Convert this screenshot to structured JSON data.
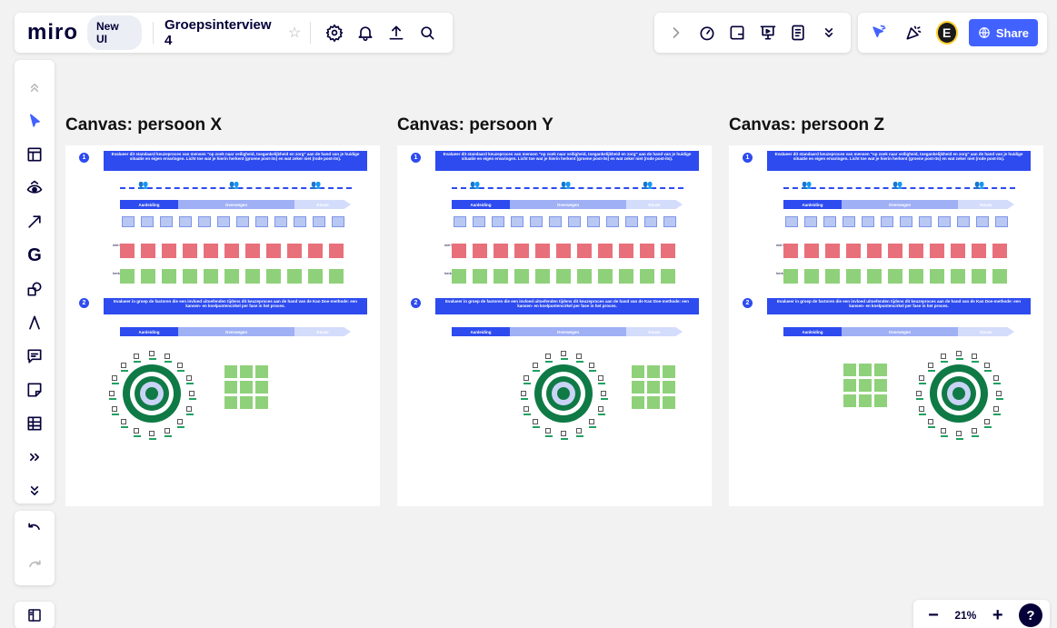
{
  "topbar": {
    "logo": "miro",
    "new_ui_label": "New UI",
    "board_name": "Groepsinterview 4",
    "icons": [
      "star-icon",
      "settings-icon",
      "bell-icon",
      "upload-icon",
      "search-icon"
    ]
  },
  "collab_toolbar": {
    "icons": [
      "chevron-right-icon",
      "timer-icon",
      "frame-icon",
      "presentation-icon",
      "notes-icon",
      "chevron-double-down-icon"
    ]
  },
  "share_toolbar": {
    "icons": [
      "cursor-reactions-icon",
      "party-icon"
    ],
    "avatar_initial": "E",
    "share_label": "Share"
  },
  "left_toolbar": {
    "tools": [
      "collapse-up-icon",
      "select-cursor-icon",
      "templates-icon",
      "ai-eye-icon",
      "arrow-line-icon",
      "g-app-icon",
      "shapes-icon",
      "pen-icon",
      "comment-icon",
      "sticky-note-icon",
      "table-icon",
      "more-tools-icon",
      "expand-down-icon"
    ]
  },
  "zoom": {
    "minus": "−",
    "value": "21%",
    "plus": "+",
    "help": "?"
  },
  "canvases": [
    {
      "title": "Canvas: persoon X",
      "step1_number": "1",
      "step1_text": "Evalueer dit standaard keuzeproces van mensen \"op zoek naar veiligheid, toegankelijkheid en zorg\" aan de hand van je huidige situatie en eigen ervaringen. Licht toe wat je hierin herkent (groene post-its) en wat zeker niet (rode post-its).",
      "phases": [
        "Aanleiding",
        "Overwegen",
        "Keuze"
      ],
      "red_label": "niet herkend",
      "green_label": "herkend",
      "step2_number": "2",
      "step2_text": "Evalueer in groep de factoren die een invloed uitoefenden tijdens dit keuzeproces aan de hand van de Kan Doe-methode: een kansen- en knelpuntencirkel per fase in het proces.",
      "circle_side": "left"
    },
    {
      "title": "Canvas: persoon Y",
      "step1_number": "1",
      "step1_text": "Evalueer dit standaard keuzeproces van mensen \"op zoek naar veiligheid, toegankelijkheid en zorg\" aan de hand van je huidige situatie en eigen ervaringen. Licht toe wat je hierin herkent (groene post-its) en wat zeker niet (rode post-its).",
      "phases": [
        "Aanleiding",
        "Overwegen",
        "Keuze"
      ],
      "red_label": "niet herkend",
      "green_label": "herkend",
      "step2_number": "2",
      "step2_text": "Evalueer in groep de factoren die een invloed uitoefenden tijdens dit keuzeproces aan de hand van de Kan Doe-methode: een kansen- en knelpuntencirkel per fase in het proces.",
      "circle_side": "right"
    },
    {
      "title": "Canvas: persoon Z",
      "step1_number": "1",
      "step1_text": "Evalueer dit standaard keuzeproces van mensen \"op zoek naar veiligheid, toegankelijkheid en zorg\" aan de hand van je huidige situatie en eigen ervaringen. Licht toe wat je hierin herkent (groene post-its) en wat zeker niet (rode post-its).",
      "phases": [
        "Aanleiding",
        "Overwegen",
        "Keuze"
      ],
      "red_label": "niet herkend",
      "green_label": "herkend",
      "step2_number": "2",
      "step2_text": "Evalueer in groep de factoren die een invloed uitoefenden tijdens dit keuzeproces aan de hand van de Kan Doe-methode: een kansen- en knelpuntencirkel per fase in het proces.",
      "circle_side": "right"
    }
  ],
  "colors": {
    "accent": "#4262ff",
    "canvas_blue": "#2d4bef",
    "sticky_red": "#e8707a",
    "sticky_green": "#8fd17a",
    "target_green": "#0f7a45",
    "target_light": "#c9d3f5"
  }
}
